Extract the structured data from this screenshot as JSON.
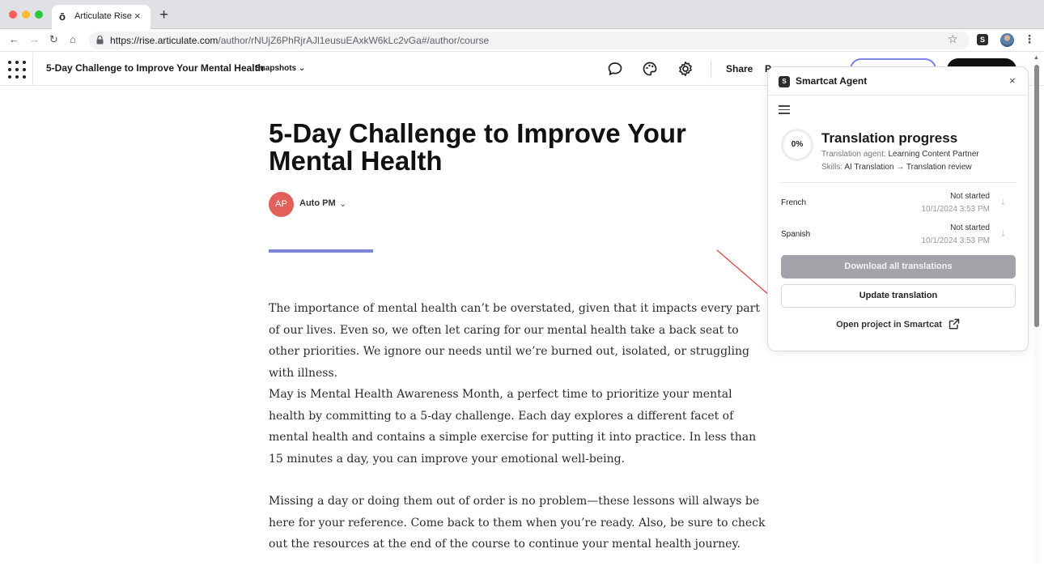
{
  "browser": {
    "tab_title": "Articulate Rise",
    "tab_favicon": "ō",
    "tab_close": "×",
    "new_tab": "+",
    "url_host": "https://rise.articulate.com",
    "url_path": "/author/rNUjZ6PhRjrAJl1eusuEAxkW6kLc2vGa#/author/course",
    "nav_back": "←",
    "nav_forward": "→",
    "nav_reload": "↻",
    "nav_home": "⌂",
    "star": "☆",
    "extension_glyph": "S",
    "menu": "⋮"
  },
  "rise_header": {
    "course_title": "5-Day Challenge to Improve Your Mental Health",
    "snapshots_label": "Snapshots",
    "snapshots_caret": "⌄",
    "share_label": "Share",
    "clipped_label": "P"
  },
  "lesson": {
    "title": "5-Day Challenge to Improve Your Mental Health",
    "author_initials": "AP",
    "author_name": "Auto PM",
    "author_caret": "⌄",
    "paragraphs": [
      "The importance of mental health can’t be overstated, given that it impacts every part of our lives. Even so, we often let caring for our mental health take a back seat to other priorities. We ignore our needs until we’re burned out, isolated, or struggling with illness.",
      "May is Mental Health Awareness Month, a perfect time to prioritize your mental health by committing to a 5-day challenge. Each day explores a different facet of mental health and contains a simple exercise for putting it into practice. In less than 15 minutes a day, you can improve your emotional well-being.",
      "Missing a day or doing them out of order is no problem—these lessons will always be here for your reference. Come back to them when you’re ready. Also, be sure to check out the resources at the end of the course to continue your mental health journey."
    ]
  },
  "panel": {
    "logo_glyph": "S",
    "title": "Smartcat Agent",
    "close": "×",
    "progress_percent": "0%",
    "progress_title": "Translation progress",
    "agent_label": "Translation agent:",
    "agent_value": "Learning Content Partner",
    "skills_label": "Skills:",
    "skills_value": "AI Translation → Translation review",
    "languages": [
      {
        "name": "French",
        "status": "Not started",
        "date": "10/1/2024 3:53 PM",
        "download_glyph": "⤓"
      },
      {
        "name": "Spanish",
        "status": "Not started",
        "date": "10/1/2024 3:53 PM",
        "download_glyph": "⤓"
      }
    ],
    "download_all_label": "Download all translations",
    "update_label": "Update translation",
    "open_project_label": "Open project in Smartcat"
  },
  "colors": {
    "accent_line": "#7c86d8",
    "avatar": "#e2605a",
    "annotation_arrow": "#e53935",
    "disabled_button": "#a4a3a9"
  }
}
